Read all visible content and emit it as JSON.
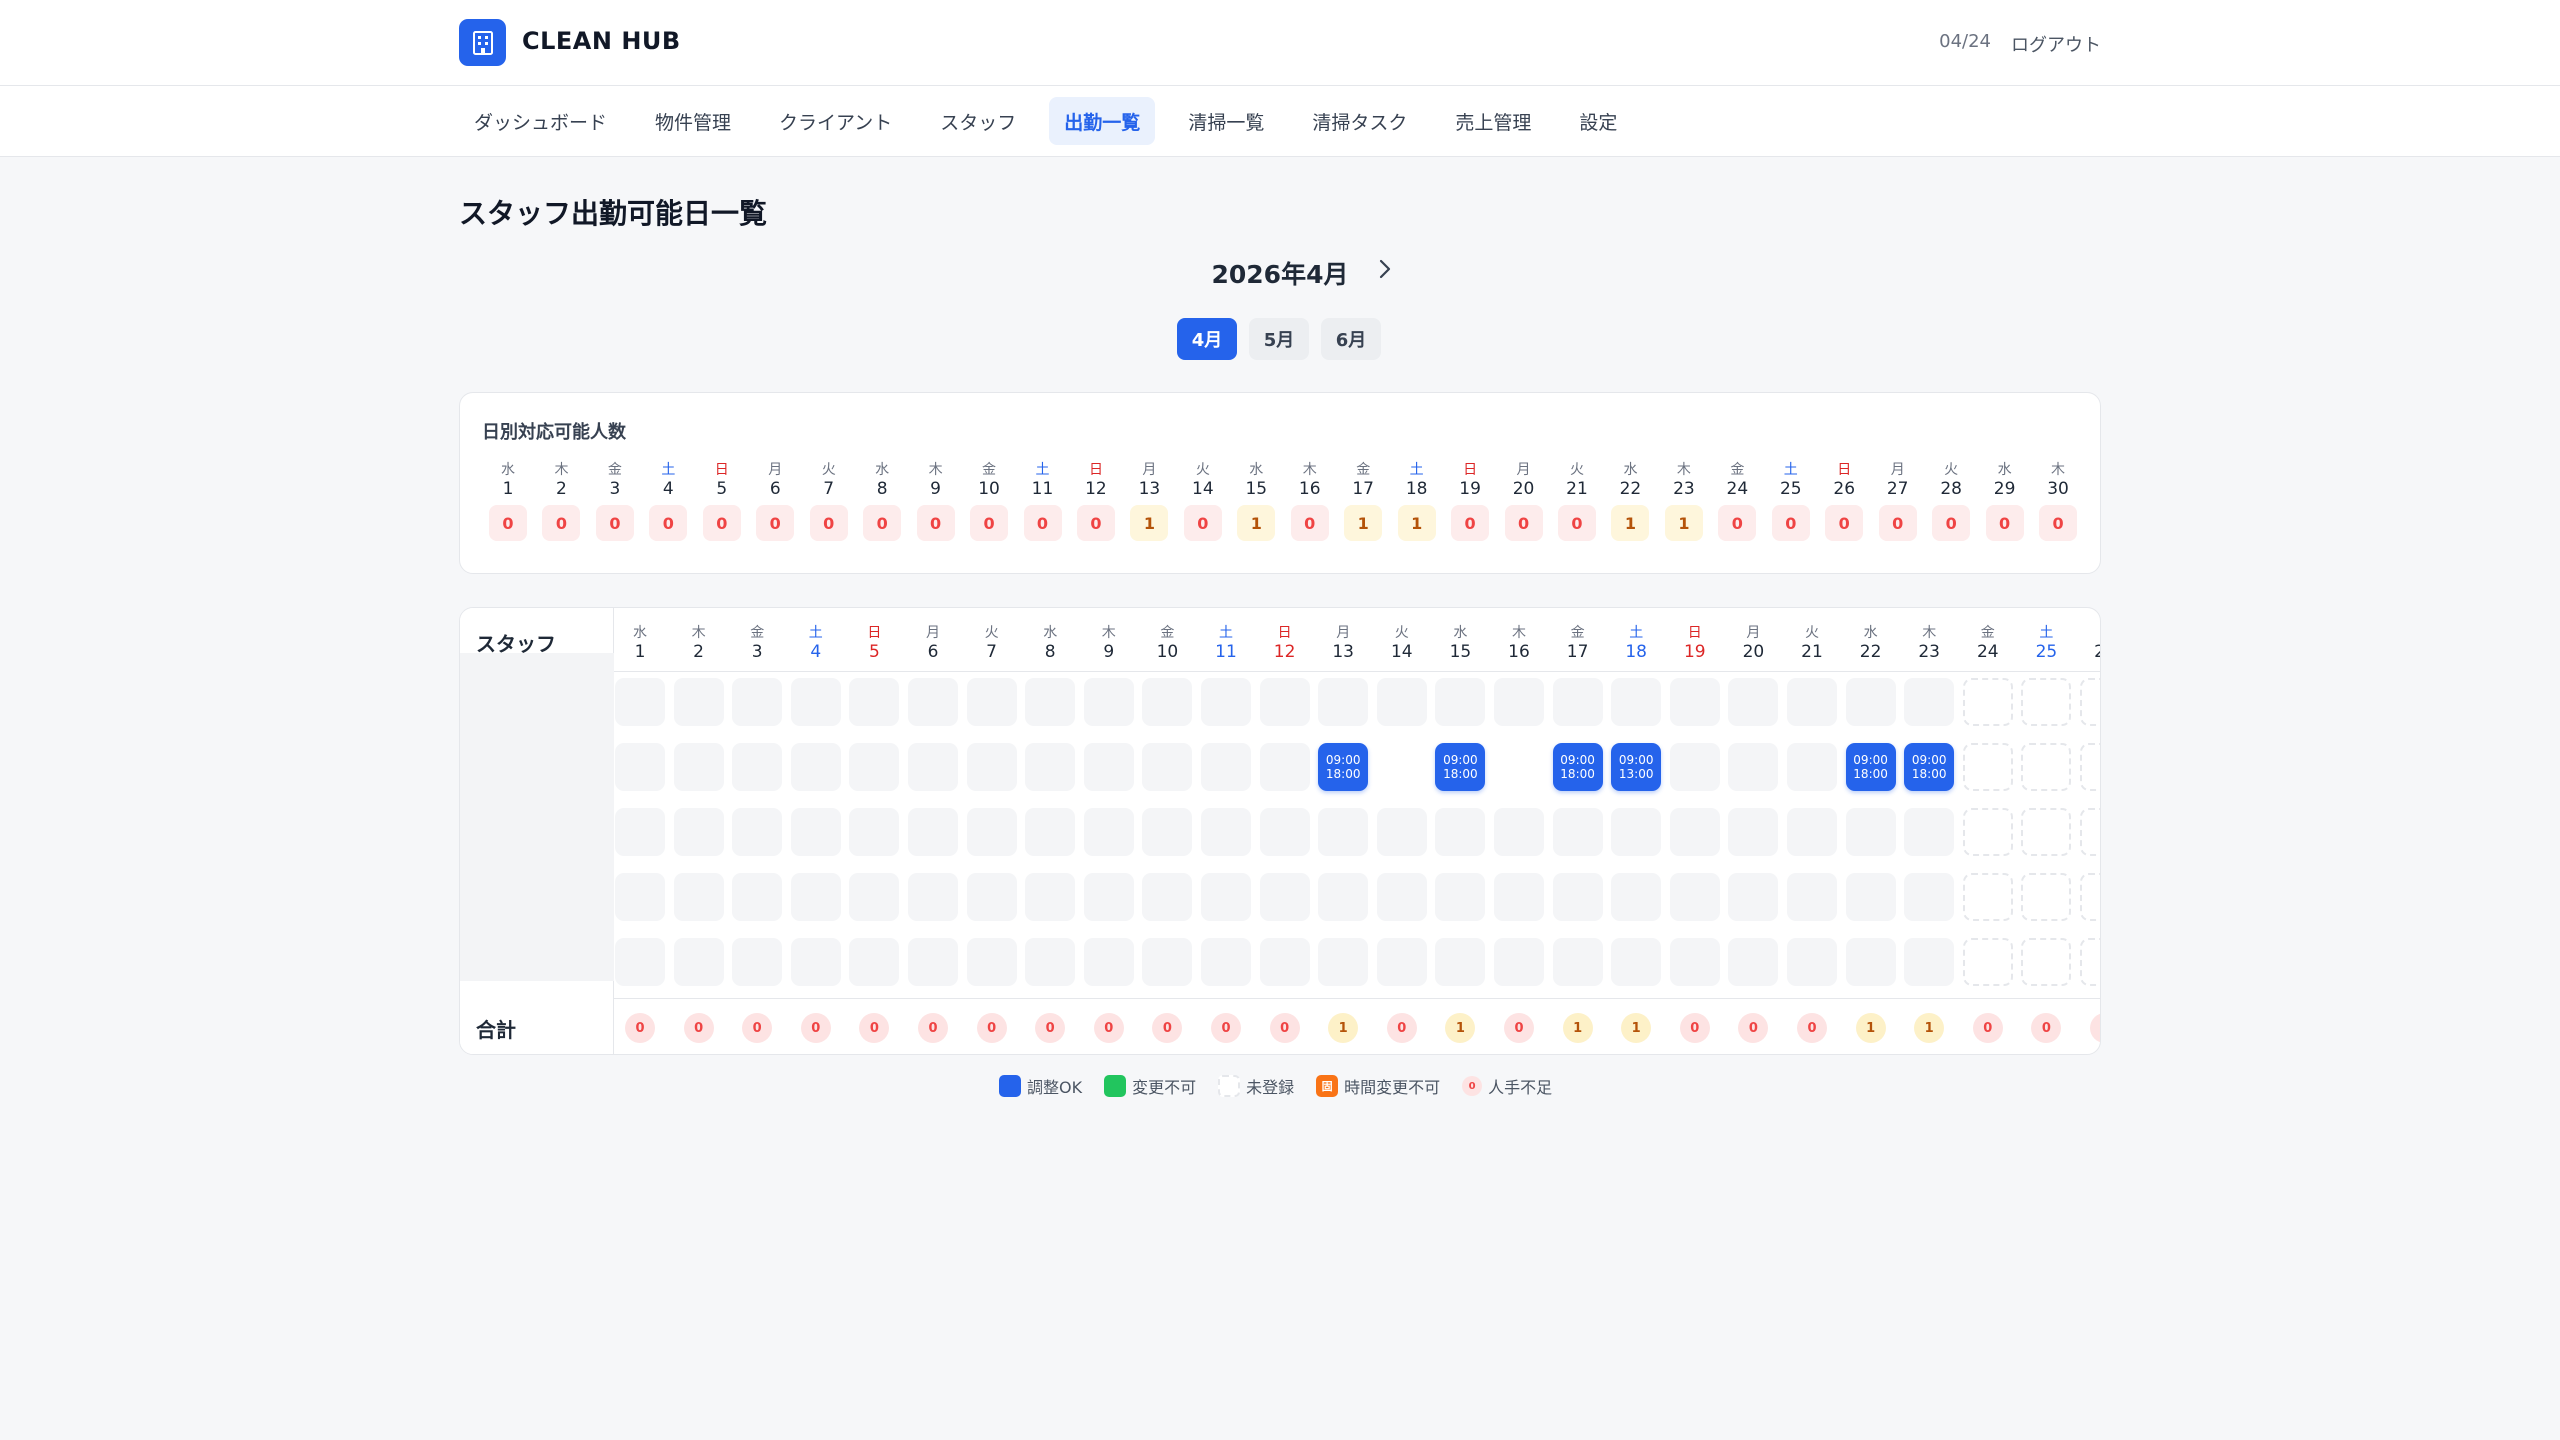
{
  "header": {
    "app_name": "CLEAN HUB",
    "date": "04/24",
    "logout": "ログアウト"
  },
  "nav": [
    "ダッシュボード",
    "物件管理",
    "クライアント",
    "スタッフ",
    "出勤一覧",
    "清掃一覧",
    "清掃タスク",
    "売上管理",
    "設定"
  ],
  "nav_active_index": 4,
  "page_title": "スタッフ出勤可能日一覧",
  "month_label": "2026年4月",
  "month_tabs": [
    "4月",
    "5月",
    "6月"
  ],
  "month_tab_active_index": 0,
  "daily_title": "日別対応可能人数",
  "days": [
    {
      "d": "1",
      "w": "水",
      "c": "0"
    },
    {
      "d": "2",
      "w": "木",
      "c": "0"
    },
    {
      "d": "3",
      "w": "金",
      "c": "0"
    },
    {
      "d": "4",
      "w": "土",
      "c": "0"
    },
    {
      "d": "5",
      "w": "日",
      "c": "0"
    },
    {
      "d": "6",
      "w": "月",
      "c": "0"
    },
    {
      "d": "7",
      "w": "火",
      "c": "0"
    },
    {
      "d": "8",
      "w": "水",
      "c": "0"
    },
    {
      "d": "9",
      "w": "木",
      "c": "0"
    },
    {
      "d": "10",
      "w": "金",
      "c": "0"
    },
    {
      "d": "11",
      "w": "土",
      "c": "0"
    },
    {
      "d": "12",
      "w": "日",
      "c": "0"
    },
    {
      "d": "13",
      "w": "月",
      "c": "1"
    },
    {
      "d": "14",
      "w": "火",
      "c": "0"
    },
    {
      "d": "15",
      "w": "水",
      "c": "1"
    },
    {
      "d": "16",
      "w": "木",
      "c": "0"
    },
    {
      "d": "17",
      "w": "金",
      "c": "1"
    },
    {
      "d": "18",
      "w": "土",
      "c": "1"
    },
    {
      "d": "19",
      "w": "日",
      "c": "0"
    },
    {
      "d": "20",
      "w": "月",
      "c": "0"
    },
    {
      "d": "21",
      "w": "火",
      "c": "0"
    },
    {
      "d": "22",
      "w": "水",
      "c": "1"
    },
    {
      "d": "23",
      "w": "木",
      "c": "1"
    },
    {
      "d": "24",
      "w": "金",
      "c": "0"
    },
    {
      "d": "25",
      "w": "土",
      "c": "0"
    },
    {
      "d": "26",
      "w": "日",
      "c": "0"
    },
    {
      "d": "27",
      "w": "月",
      "c": "0"
    },
    {
      "d": "28",
      "w": "火",
      "c": "0"
    },
    {
      "d": "29",
      "w": "水",
      "c": "0"
    },
    {
      "d": "30",
      "w": "木",
      "c": "0"
    }
  ],
  "grid": {
    "staff_header": "スタッフ",
    "total_label": "合計",
    "shifts": [
      {
        "day": "13",
        "start": "09:00",
        "end": "18:00"
      },
      {
        "day": "15",
        "start": "09:00",
        "end": "18:00"
      },
      {
        "day": "17",
        "start": "09:00",
        "end": "18:00"
      },
      {
        "day": "18",
        "start": "09:00",
        "end": "13:00"
      },
      {
        "day": "22",
        "start": "09:00",
        "end": "18:00"
      },
      {
        "day": "23",
        "start": "09:00",
        "end": "18:00"
      }
    ]
  },
  "legend": [
    {
      "label": "調整OK",
      "swatch": "blue"
    },
    {
      "label": "変更不可",
      "swatch": "green"
    },
    {
      "label": "未登録",
      "swatch": "none"
    },
    {
      "label": "時間変更不可",
      "swatch": "orange",
      "glyph": "固"
    },
    {
      "label": "人手不足",
      "swatch": "short",
      "glyph": "0"
    }
  ],
  "colors": {
    "primary": "#2563eb",
    "saturday": "#2563eb",
    "sunday": "#dc2626",
    "shortage": "#ef4444",
    "partial": "#b45309"
  }
}
